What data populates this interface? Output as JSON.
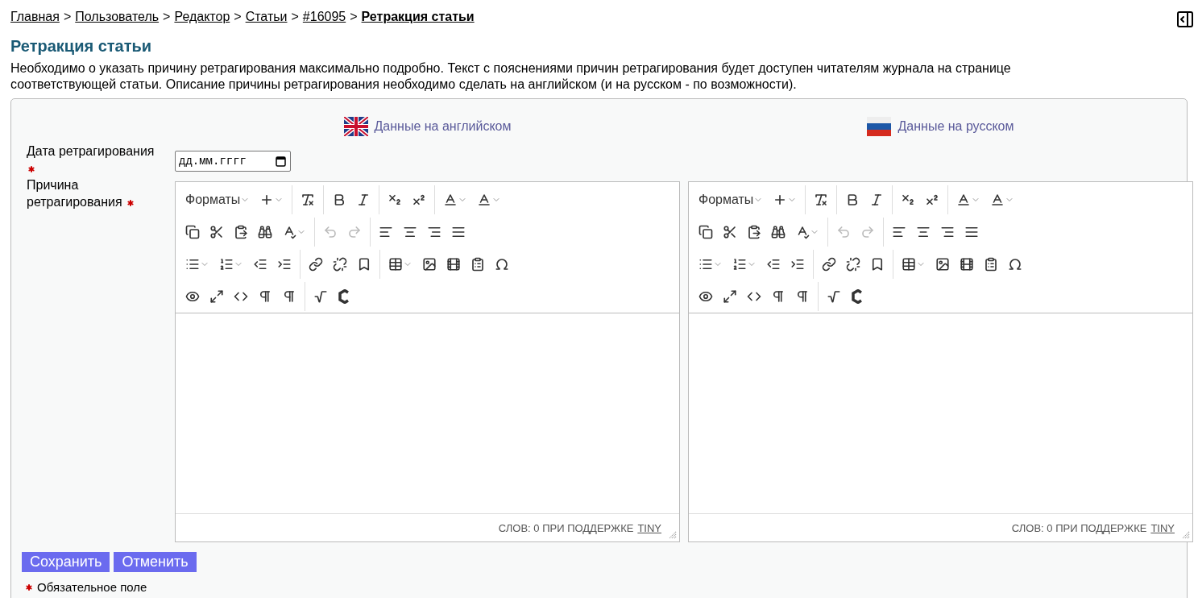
{
  "breadcrumbs": [
    {
      "label": "Главная",
      "current": false
    },
    {
      "separator": ">",
      "label": "Пользователь",
      "current": false
    },
    {
      "separator": ">",
      "label": "Редактор",
      "current": false
    },
    {
      "separator": ">",
      "label": "Статьи",
      "current": false
    },
    {
      "separator": ">",
      "label": "#16095",
      "current": false
    },
    {
      "separator": ">",
      "label": "Ретракция статьи",
      "current": true
    }
  ],
  "title": "Ретракция статьи",
  "description": "Необходимо о указать причину ретрагирования максимально подробно. Текст с пояснениями причин ретрагирования будет доступен читателям журнала на странице соответствующей статьи. Описание причины ретрагирования необходимо сделать на английском (и на русском - по возможности).",
  "languages": [
    {
      "kind": "uk",
      "label": "Данные на английском"
    },
    {
      "kind": "ru",
      "label": "Данные на русском"
    }
  ],
  "fields": [
    {
      "label": "Дата ретрагирования",
      "required": true,
      "kind": "date",
      "placeholder": "дд.мм.гггг"
    },
    {
      "label": "Причина ретрагирования",
      "required": true,
      "kind": "editors"
    }
  ],
  "editors": [
    {
      "formats": "Форматы",
      "undo_disabled": true,
      "redo_disabled": true,
      "status": "СЛОВ: 0 ПРИ ПОДДЕРЖКЕ",
      "link": "TINY"
    },
    {
      "formats": "Форматы",
      "undo_disabled": true,
      "redo_disabled": true,
      "status": "СЛОВ: 0 ПРИ ПОДДЕРЖКЕ",
      "link": "TINY"
    }
  ],
  "buttons": [
    "Сохранить",
    "Отменить"
  ],
  "required_note": "Обязательное поле"
}
